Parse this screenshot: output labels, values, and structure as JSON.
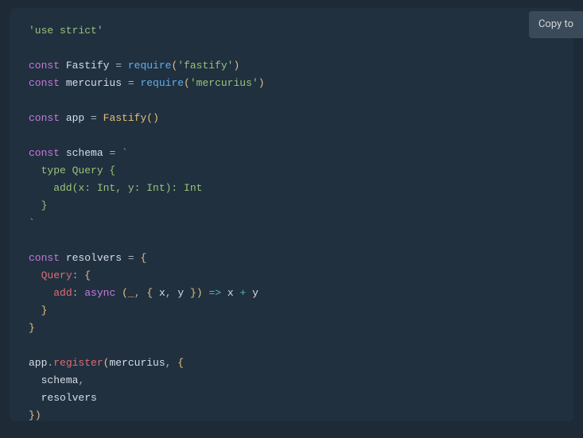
{
  "copyButton": {
    "label": "Copy to"
  },
  "code": {
    "useStrict": "'use strict'",
    "constKw": "const",
    "requireName": "require",
    "fastifyVar": "Fastify",
    "fastifyModule": "'fastify'",
    "mercuriusVar": "mercurius",
    "mercuriusModule": "'mercurius'",
    "appVar": "app",
    "fastifyCall": "Fastify",
    "schemaVar": "schema",
    "schemaBody": "`\n  type Query {\n    add(x: Int, y: Int): Int\n  }\n`",
    "resolversVar": "resolvers",
    "queryKey": "Query",
    "addKey": "add",
    "asyncKw": "async",
    "underscore": "_",
    "paramX": "x",
    "paramY": "y",
    "arrow": "=>",
    "plus": "+",
    "registerMethod": "register",
    "schemaProp": "schema",
    "resolversProp": "resolvers",
    "eq": " = ",
    "openParen": "(",
    "closeParen": ")",
    "openBrace": "{",
    "closeBrace": "}",
    "openBrack": "[",
    "closeBrack": "]",
    "comma": ",",
    "colon": ":",
    "dot": "."
  }
}
